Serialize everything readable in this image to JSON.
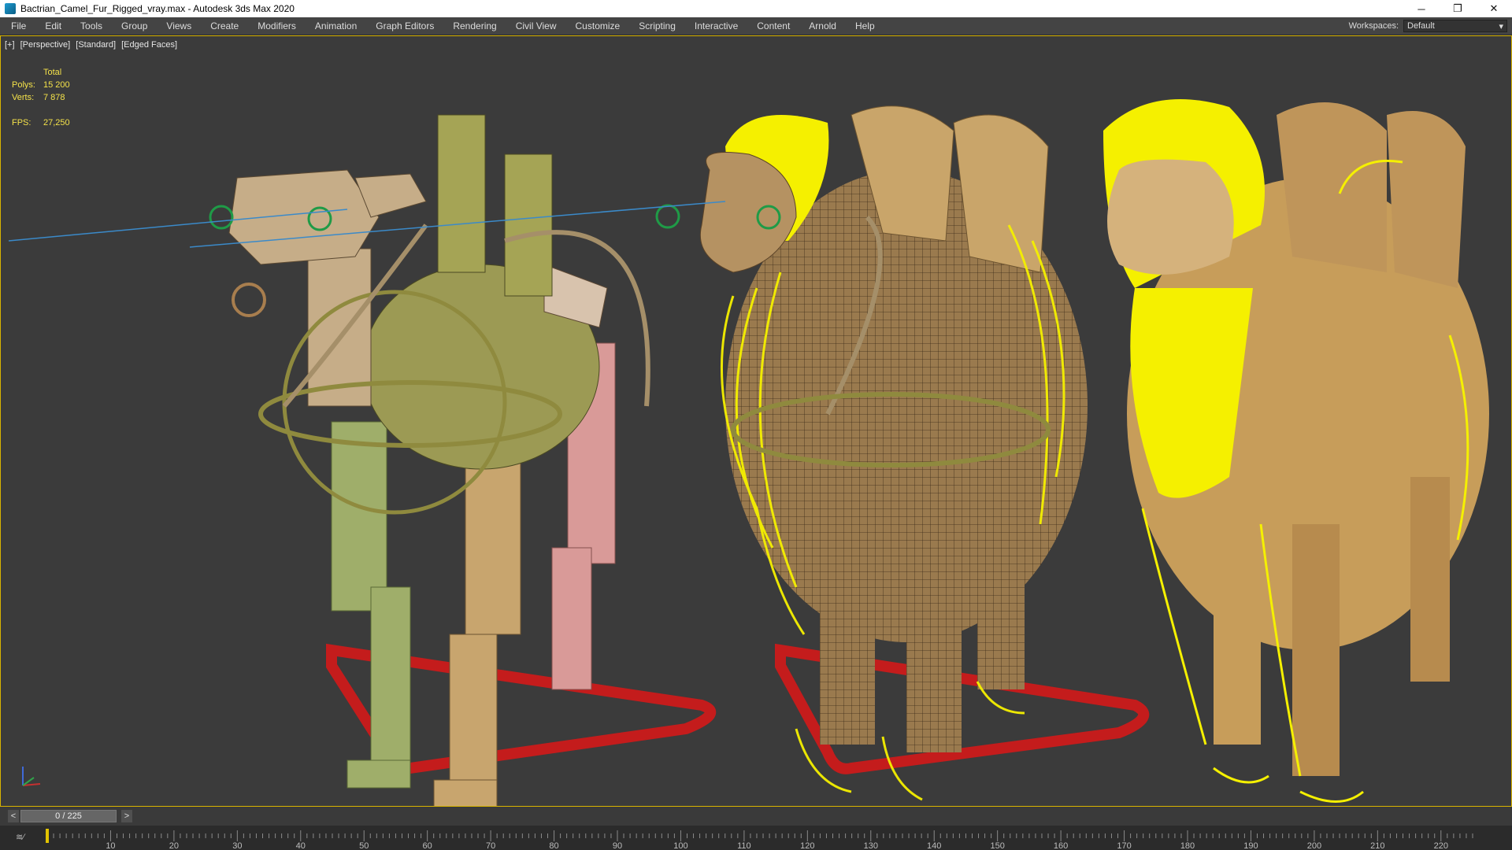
{
  "window": {
    "title": "Bactrian_Camel_Fur_Rigged_vray.max - Autodesk 3ds Max 2020",
    "buttons": [
      "─",
      "❐",
      "✕"
    ]
  },
  "menu": {
    "items": [
      "File",
      "Edit",
      "Tools",
      "Group",
      "Views",
      "Create",
      "Modifiers",
      "Animation",
      "Graph Editors",
      "Rendering",
      "Civil View",
      "Customize",
      "Scripting",
      "Interactive",
      "Content",
      "Arnold",
      "Help"
    ],
    "workspaces_label": "Workspaces:",
    "workspaces_value": "Default"
  },
  "viewport": {
    "labels": [
      "[+]",
      "[Perspective]",
      "[Standard]",
      "[Edged Faces]"
    ],
    "stats": {
      "header": "Total",
      "polys_label": "Polys:",
      "polys_value": "15 200",
      "verts_label": "Verts:",
      "verts_value": "7 878",
      "fps_label": "FPS:",
      "fps_value": "27,250"
    }
  },
  "timeline": {
    "frame": "0 / 225",
    "prev": "<",
    "next": ">",
    "ticks": [
      10,
      20,
      30,
      40,
      50,
      60,
      70,
      80,
      90,
      100,
      110,
      120,
      130,
      140,
      150,
      160,
      170,
      180,
      190,
      200,
      210,
      220
    ]
  },
  "colors": {
    "fur_yellow": "#f5f000",
    "rig_red": "#c41c1c",
    "active_border": "#d8b400"
  }
}
